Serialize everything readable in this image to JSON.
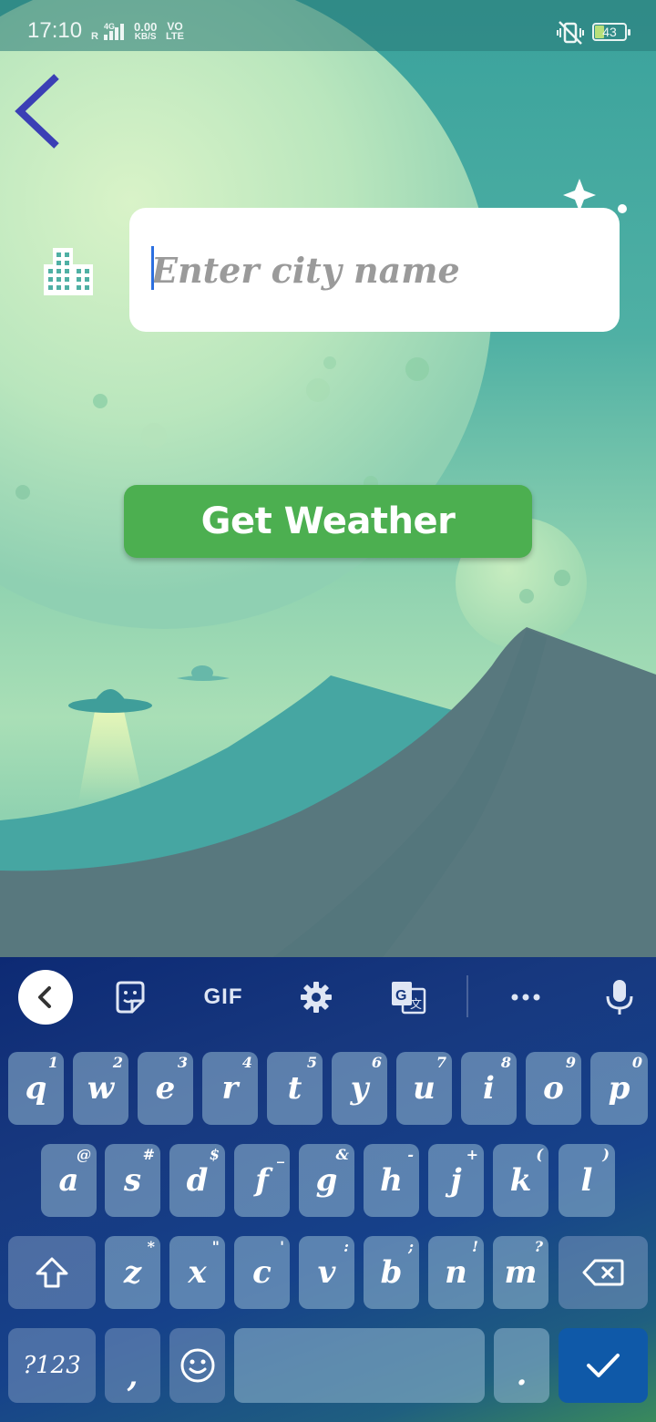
{
  "status_bar": {
    "time": "17:10",
    "network_type": "4G",
    "roaming": "R",
    "data_rate": "0.00",
    "data_rate_unit": "KB/S",
    "volte_line1": "VO",
    "volte_line2": "LTE",
    "battery_level": "43",
    "silent_icon": "vibrate-off-icon"
  },
  "app": {
    "back_icon": "chevron-left-icon",
    "city_icon": "city-buildings-icon",
    "city_input": {
      "value": "",
      "placeholder": "Enter city name"
    },
    "get_weather_label": "Get Weather",
    "colors": {
      "button": "#4caf50",
      "back_arrow": "#3b3fb5",
      "input_bg": "#ffffff"
    }
  },
  "keyboard": {
    "toolbar": {
      "collapse_icon": "chevron-left-icon",
      "sticker_icon": "sticker-icon",
      "gif_label": "GIF",
      "settings_icon": "gear-icon",
      "translate_icon": "translate-icon",
      "more_icon": "more-horizontal-icon",
      "mic_icon": "microphone-icon"
    },
    "row1": [
      {
        "key": "q",
        "hint": "1"
      },
      {
        "key": "w",
        "hint": "2"
      },
      {
        "key": "e",
        "hint": "3"
      },
      {
        "key": "r",
        "hint": "4"
      },
      {
        "key": "t",
        "hint": "5"
      },
      {
        "key": "y",
        "hint": "6"
      },
      {
        "key": "u",
        "hint": "7"
      },
      {
        "key": "i",
        "hint": "8"
      },
      {
        "key": "o",
        "hint": "9"
      },
      {
        "key": "p",
        "hint": "0"
      }
    ],
    "row2": [
      {
        "key": "a",
        "hint": "@"
      },
      {
        "key": "s",
        "hint": "#"
      },
      {
        "key": "d",
        "hint": "$"
      },
      {
        "key": "f",
        "hint": "_"
      },
      {
        "key": "g",
        "hint": "&"
      },
      {
        "key": "h",
        "hint": "-"
      },
      {
        "key": "j",
        "hint": "+"
      },
      {
        "key": "k",
        "hint": "("
      },
      {
        "key": "l",
        "hint": ")"
      }
    ],
    "row3": [
      {
        "key": "z",
        "hint": "*"
      },
      {
        "key": "x",
        "hint": "\""
      },
      {
        "key": "c",
        "hint": "'"
      },
      {
        "key": "v",
        "hint": ":"
      },
      {
        "key": "b",
        "hint": ";"
      },
      {
        "key": "n",
        "hint": "!"
      },
      {
        "key": "m",
        "hint": "?"
      }
    ],
    "shift_icon": "shift-icon",
    "backspace_icon": "backspace-icon",
    "symbols_label": "?123",
    "comma_label": ",",
    "emoji_icon": "emoji-icon",
    "period_label": ".",
    "enter_icon": "checkmark-icon"
  }
}
